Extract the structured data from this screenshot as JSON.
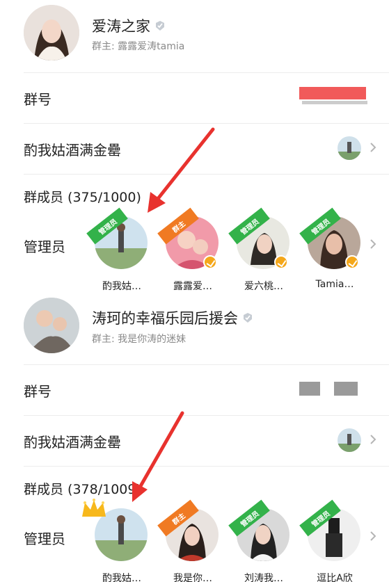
{
  "groups": [
    {
      "name": "爱涛之家",
      "owner": "群主: 露露爱涛tamia",
      "group_number_label": "群号",
      "group_number_fragment": "",
      "my_nickname": "酌我姑酒满金罍",
      "members_count": "群成员 (375/1000)",
      "admin_label": "管理员",
      "admins": [
        {
          "name": "酌我姑…",
          "role": "管理员",
          "role_color": "green",
          "verified": false
        },
        {
          "name": "露露爱…",
          "role": "群主",
          "role_color": "orange",
          "verified": true
        },
        {
          "name": "爱六桃…",
          "role": "管理员",
          "role_color": "green",
          "verified": true
        },
        {
          "name": "Tamia…",
          "role": "管理员",
          "role_color": "green",
          "verified": true
        }
      ]
    },
    {
      "name": "涛珂的幸福乐园后援会",
      "owner": "群主: 我是你涛的迷妹",
      "group_number_label": "群号",
      "my_nickname": "酌我姑酒满金罍",
      "members_count": "群成员 (378/1009)",
      "admin_label": "管理员",
      "admins": [
        {
          "name": "酌我姑…",
          "role": "",
          "role_color": "none",
          "verified": false
        },
        {
          "name": "我是你…",
          "role": "群主",
          "role_color": "orange",
          "verified": false
        },
        {
          "name": "刘涛我…",
          "role": "管理员",
          "role_color": "green",
          "verified": false
        },
        {
          "name": "逗比A欣",
          "role": "管理员",
          "role_color": "green",
          "verified": false
        }
      ]
    }
  ],
  "colors": {
    "accent_green": "#33b24a",
    "accent_orange": "#f07a23",
    "redaction": "#f15a5a",
    "arrow": "#e8322e"
  },
  "icons": [
    "verified-badge-icon",
    "chevron-right-icon",
    "crown-icon",
    "arrow-annotation"
  ]
}
